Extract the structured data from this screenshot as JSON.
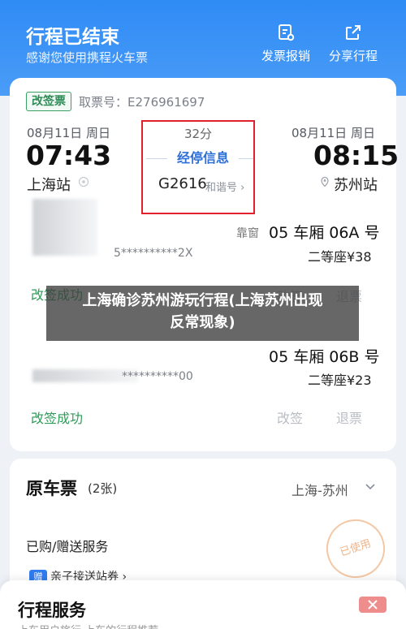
{
  "header": {
    "title": "行程已结束",
    "subtitle": "感谢您使用携程火车票",
    "report_label": "发票报销",
    "share_label": "分享行程",
    "report_icon": "receipt-icon",
    "share_icon": "share-icon"
  },
  "ticket": {
    "tag": "改签票",
    "ticket_no": "取票号：E276961697",
    "depart": {
      "date": "08月11日 周日",
      "time": "07:43",
      "station": "上海站"
    },
    "arrive": {
      "date": "08月11日 周日",
      "time": "08:15",
      "station": "苏州站"
    },
    "duration": "32分",
    "stops_label": "经停信息",
    "train_no": "G2616",
    "train_type": "和谐号 ›"
  },
  "passengers": [
    {
      "seat_position": "靠窗",
      "car_seat": "05 车厢 06A 号",
      "id_masked": "5**********2X",
      "seat_class": "二等座¥38",
      "status": "改签成功",
      "actions": [
        "改签",
        "退票"
      ]
    },
    {
      "car_seat": "05 车厢 06B 号",
      "id_masked": "**********00",
      "seat_class": "二等座¥23",
      "status": "改签成功",
      "actions": [
        "改签",
        "退票"
      ]
    }
  ],
  "overlay": {
    "line1": "上海确诊苏州游玩行程(上海苏州出现",
    "line2": "反常现象)"
  },
  "original": {
    "title": "原车票",
    "count": "(2张)",
    "route": "上海-苏州"
  },
  "services": {
    "title": "已购/赠送服务",
    "chip_mark": "赠",
    "chip_label": "亲子接送站券 ›",
    "stamp": "已使用"
  },
  "sheet": {
    "title": "行程服务",
    "subtitle": "上车用户旅行  上车的行程推荐"
  },
  "colors": {
    "header": "#2f8bf5",
    "accent_green": "#2f9a5a",
    "link_blue": "#2c6fd8",
    "highlight_red": "#e0202a"
  }
}
